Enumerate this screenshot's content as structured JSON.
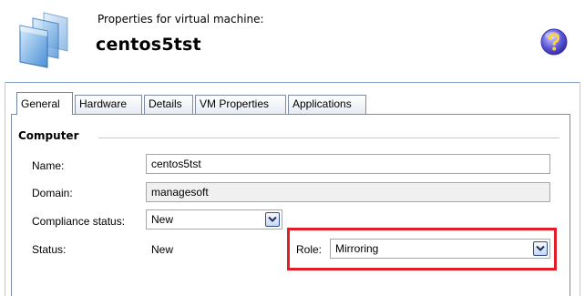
{
  "header": {
    "subtitle": "Properties for virtual machine:",
    "title": "centos5tst",
    "icons": [
      "virtual-machine-icon",
      "help-icon"
    ]
  },
  "tabs": [
    {
      "label": "General",
      "active": true
    },
    {
      "label": "Hardware",
      "active": false
    },
    {
      "label": "Details",
      "active": false
    },
    {
      "label": "VM Properties",
      "active": false
    },
    {
      "label": "Applications",
      "active": false
    }
  ],
  "computer": {
    "group_title": "Computer",
    "name_label": "Name:",
    "name_value": "centos5tst",
    "domain_label": "Domain:",
    "domain_value": "managesoft",
    "compliance_label": "Compliance status:",
    "compliance_value": "New",
    "status_label": "Status:",
    "status_value": "New",
    "role_label": "Role:",
    "role_value": "Mirroring"
  },
  "colors": {
    "highlight": "#e21f26",
    "tab_border": "#7a8ca6",
    "header_separator": "#7fa0c7"
  }
}
